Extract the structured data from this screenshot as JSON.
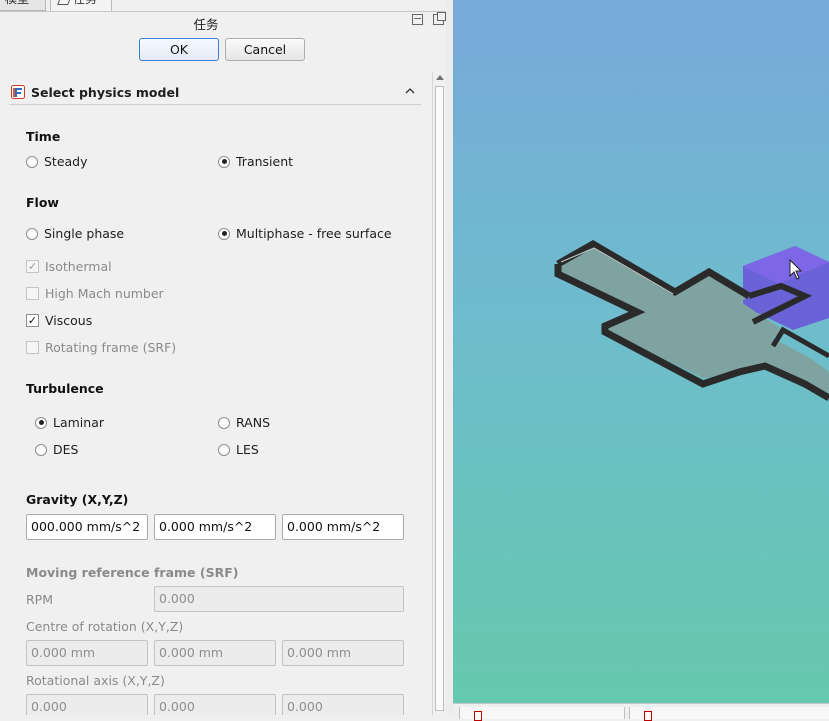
{
  "tabs": [
    {
      "label": "模型",
      "active": false
    },
    {
      "label": "任务",
      "active": true
    }
  ],
  "panel": {
    "title": "任务",
    "ok_label": "OK",
    "cancel_label": "Cancel"
  },
  "section": {
    "title": "Select physics model"
  },
  "time": {
    "label": "Time",
    "options": [
      {
        "label": "Steady",
        "selected": false
      },
      {
        "label": "Transient",
        "selected": true
      }
    ]
  },
  "flow": {
    "label": "Flow",
    "options": [
      {
        "label": "Single phase",
        "selected": false
      },
      {
        "label": "Multiphase - free surface",
        "selected": true
      }
    ],
    "checks": [
      {
        "label": "Isothermal",
        "checked": true,
        "enabled": false
      },
      {
        "label": "High Mach number",
        "checked": false,
        "enabled": false
      },
      {
        "label": "Viscous",
        "checked": true,
        "enabled": true
      },
      {
        "label": "Rotating frame (SRF)",
        "checked": false,
        "enabled": false
      }
    ]
  },
  "turbulence": {
    "label": "Turbulence",
    "options": [
      {
        "label": "Laminar",
        "selected": true
      },
      {
        "label": "RANS",
        "selected": false
      },
      {
        "label": "DES",
        "selected": false
      },
      {
        "label": "LES",
        "selected": false
      }
    ]
  },
  "gravity": {
    "label": "Gravity (X,Y,Z)",
    "values": [
      "000.000 mm/s^2",
      "0.000 mm/s^2",
      "0.000 mm/s^2"
    ]
  },
  "srf": {
    "label": "Moving reference frame (SRF)",
    "rpm_label": "RPM",
    "rpm_value": "0.000",
    "centre_label": "Centre of rotation (X,Y,Z)",
    "centre_values": [
      "0.000 mm",
      "0.000 mm",
      "0.000 mm"
    ],
    "axis_label": "Rotational axis (X,Y,Z)",
    "axis_values": [
      "0.000",
      "0.000",
      "0.000"
    ]
  },
  "colors": {
    "viewport_top": "#77a9d9",
    "viewport_bottom": "#66c8ad",
    "model_fill": "#7fa3a0",
    "model_wall": "#2a2a2a",
    "box_color": "#6a52d8",
    "accent": "#3c7fd0"
  }
}
